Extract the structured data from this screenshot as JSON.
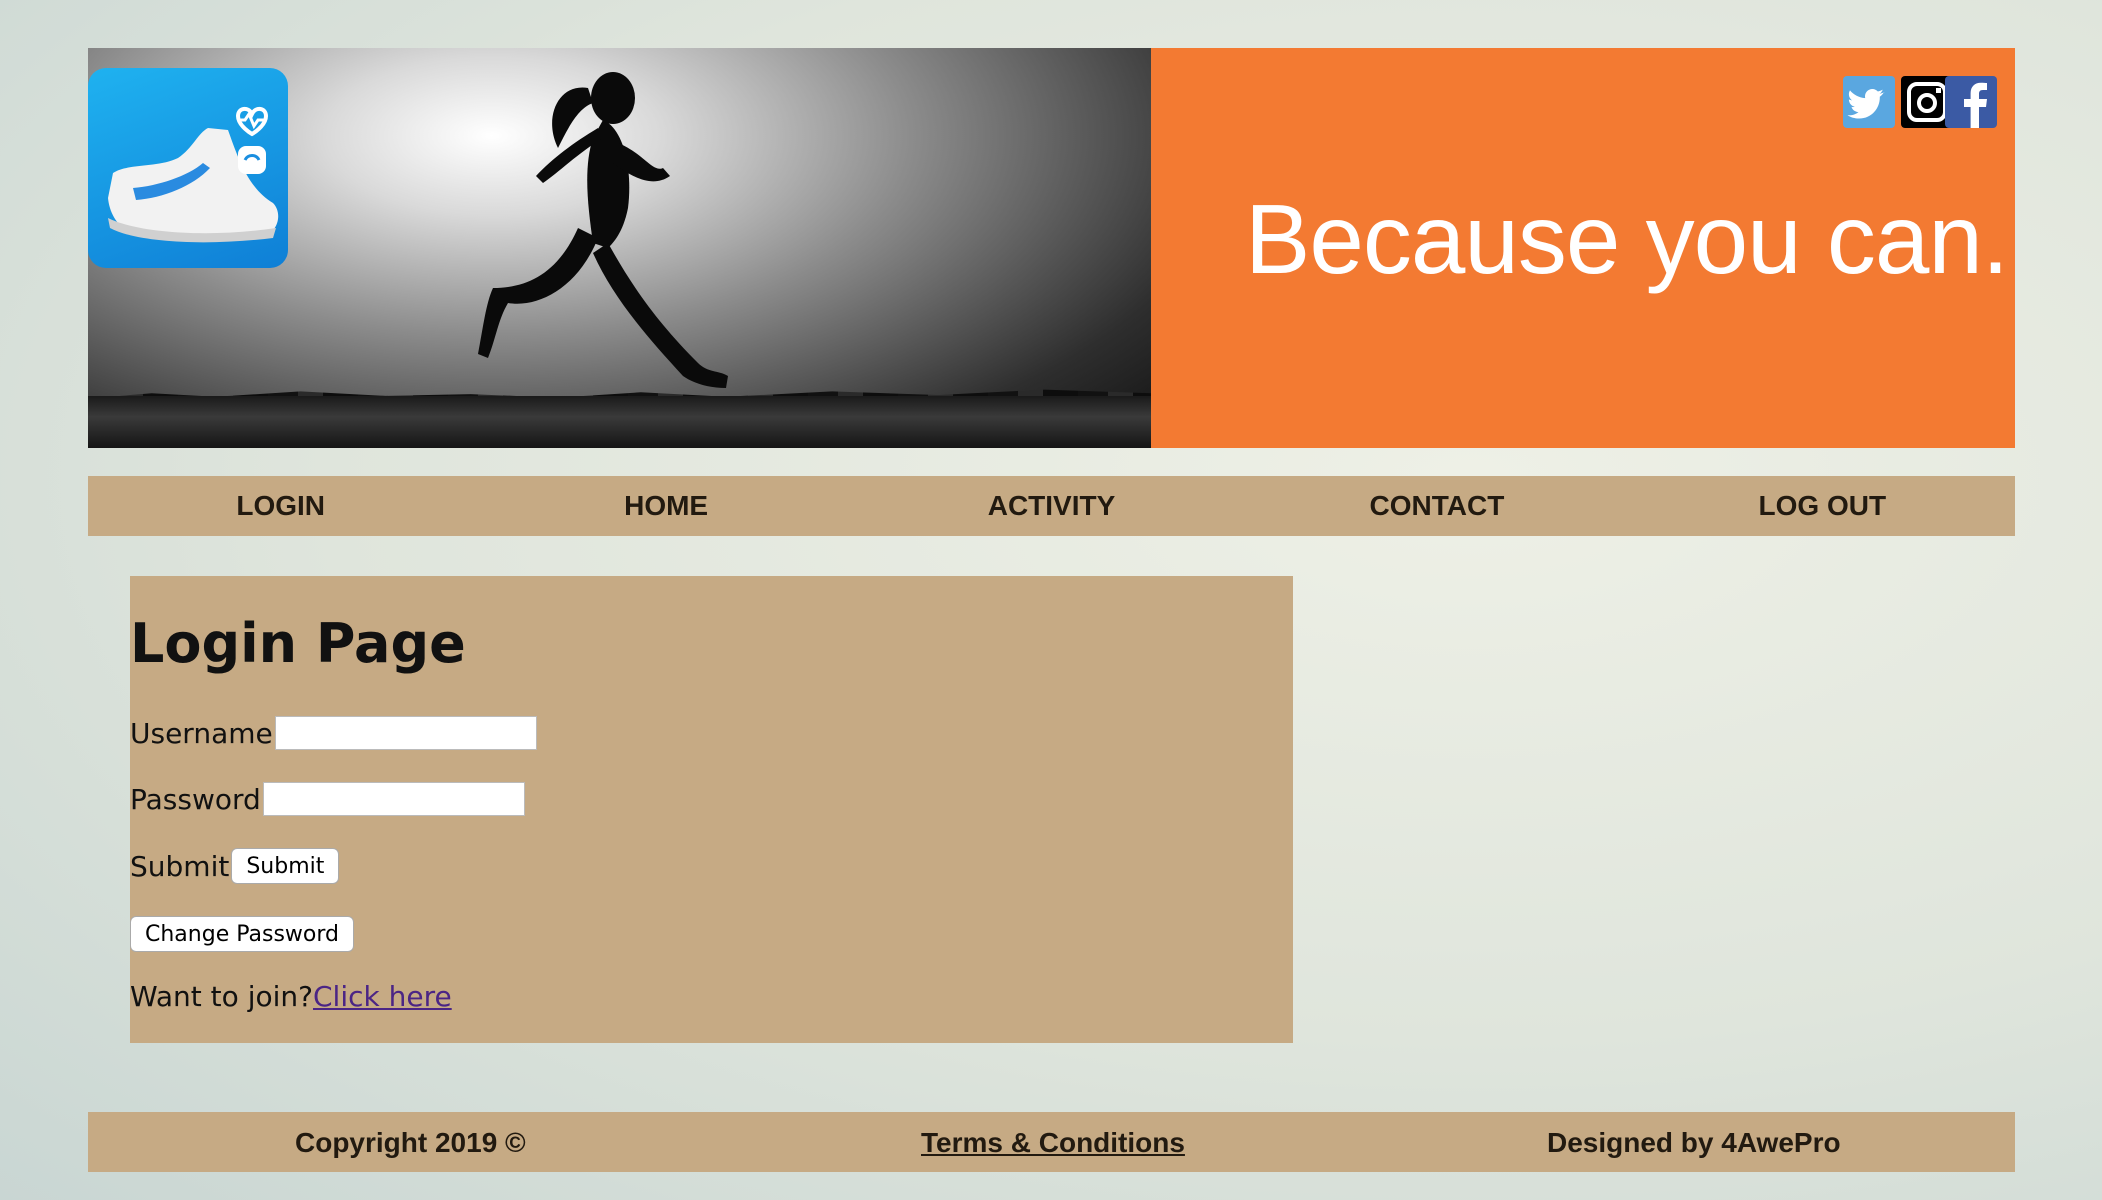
{
  "banner": {
    "slogan": "Because you can.",
    "social": [
      "twitter-icon",
      "instagram-icon",
      "facebook-icon"
    ],
    "accent_color": "#f37a32"
  },
  "nav": {
    "items": [
      "LOGIN",
      "HOME",
      "ACTIVITY",
      "CONTACT",
      "LOG OUT"
    ],
    "background": "#c6aa84"
  },
  "login": {
    "title": "Login Page",
    "username_label": "Username",
    "username_value": "",
    "password_label": "Password",
    "password_value": "",
    "submit_label": "Submit",
    "submit_button": "Submit",
    "change_password_button": "Change Password",
    "join_text": "Want to join?",
    "join_link": " Click here"
  },
  "footer": {
    "copyright": "Copyright 2019 ©",
    "terms": "Terms & Conditions",
    "designer": "Designed by 4AwePro"
  }
}
